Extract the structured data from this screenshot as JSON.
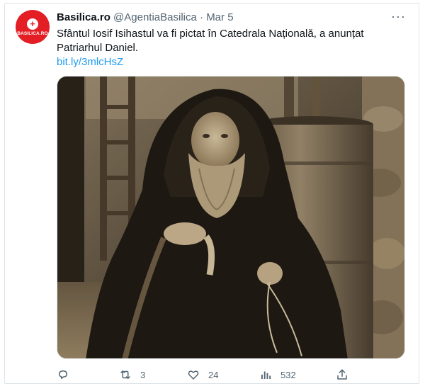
{
  "tweet": {
    "avatar": {
      "brand": "BASILICA.RO",
      "color": "#e31e24",
      "icon": "cross-icon"
    },
    "author_name": "Basilica.ro",
    "handle": "@AgentiaBasilica",
    "separator": "·",
    "date": "Mar 5",
    "more_icon": "more-icon",
    "text_line1": "Sfântul Iosif Isihastul va fi pictat în Catedrala Națională, a anunțat",
    "text_line2": "Patriarhul Daniel.",
    "link": "bit.ly/3mlcHsZ",
    "media_icon": "photo-monk",
    "actions": {
      "reply": {
        "icon": "reply-icon",
        "count": ""
      },
      "retweet": {
        "icon": "retweet-icon",
        "count": "3"
      },
      "like": {
        "icon": "heart-icon",
        "count": "24"
      },
      "views": {
        "icon": "views-icon",
        "count": "532"
      },
      "share": {
        "icon": "share-icon",
        "count": ""
      }
    }
  },
  "colors": {
    "link": "#1d9bf0",
    "muted": "#536471",
    "text": "#0f1419"
  }
}
